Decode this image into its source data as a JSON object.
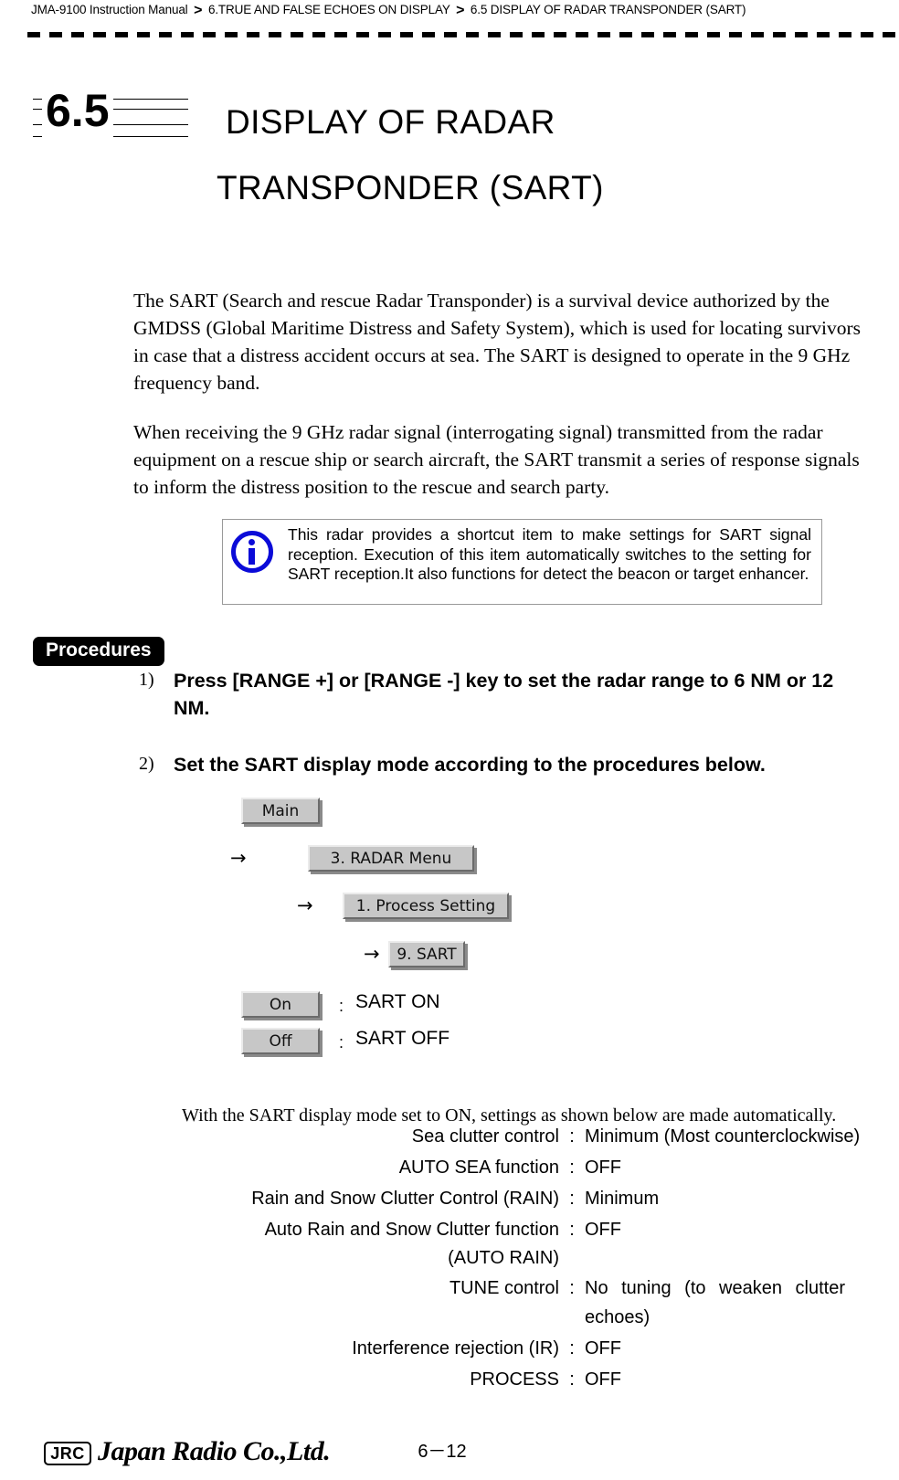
{
  "header": {
    "manual": "JMA-9100 Instruction Manual",
    "separator": ">",
    "chapter": "6.TRUE AND FALSE ECHOES ON DISPLAY",
    "section": "6.5  DISPLAY OF RADAR TRANSPONDER (SART)"
  },
  "section": {
    "number": "6.5",
    "title_line1": "DISPLAY OF RADAR",
    "title_line2": "TRANSPONDER (SART)"
  },
  "body": {
    "paragraph1": "The SART (Search and rescue Radar Transponder) is a survival device authorized by the GMDSS (Global Maritime Distress and Safety System), which is used for locating survivors in case that a distress accident occurs at sea.  The SART is designed to operate in the 9 GHz frequency band.",
    "paragraph2": "When receiving the 9 GHz radar signal (interrogating signal) transmitted from the radar equipment on a rescue ship or search aircraft, the SART transmit a series of response signals to inform the distress position to the rescue and search party."
  },
  "note": {
    "icon": "info-icon",
    "icon_color": "#0b0bd8",
    "text": "This radar provides a shortcut item to make settings for SART signal reception.  Execution of this item automatically switches to the setting for SART reception.It also functions for detect the beacon or target enhancer."
  },
  "procedures": {
    "tag": "Procedures",
    "steps": [
      {
        "number": "1)",
        "text": "Press [RANGE +] or [RANGE -] key to set the radar range to 6 NM or 12 NM."
      },
      {
        "number": "2)",
        "text": "Set the SART display mode according to the procedures below."
      }
    ]
  },
  "menu_chain": {
    "arrow": "→",
    "buttons": [
      {
        "label": "Main"
      },
      {
        "label": "3. RADAR Menu"
      },
      {
        "label": "1. Process Setting"
      },
      {
        "label": "9. SART"
      }
    ],
    "options": [
      {
        "button": "On",
        "colon": ":",
        "description": "SART ON"
      },
      {
        "button": "Off",
        "colon": ":",
        "description": "SART OFF"
      }
    ]
  },
  "auto_settings": {
    "intro": "With the SART display mode set to ON, settings as shown below are made automatically.",
    "colon": ":",
    "rows": [
      {
        "label": "Sea clutter control",
        "sub": "",
        "value": "Minimum (Most counterclockwise)",
        "justify": false
      },
      {
        "label": "AUTO SEA function",
        "sub": "",
        "value": "OFF",
        "justify": false
      },
      {
        "label": "Rain and Snow Clutter Control (RAIN)",
        "sub": "",
        "value": "Minimum",
        "justify": false
      },
      {
        "label": "Auto Rain and Snow Clutter function",
        "sub": "(AUTO RAIN)",
        "value": "OFF",
        "justify": false
      },
      {
        "label": "TUNE control",
        "sub": "",
        "value": "No tuning (to weaken clutter echoes)",
        "justify": true
      },
      {
        "label": "Interference rejection (IR)",
        "sub": "",
        "value": "OFF",
        "justify": false
      },
      {
        "label": "PROCESS",
        "sub": "",
        "value": "OFF",
        "justify": false
      }
    ]
  },
  "footer": {
    "logo_mark": "JRC",
    "company": "Japan Radio Co.,Ltd.",
    "page": "6－12"
  }
}
